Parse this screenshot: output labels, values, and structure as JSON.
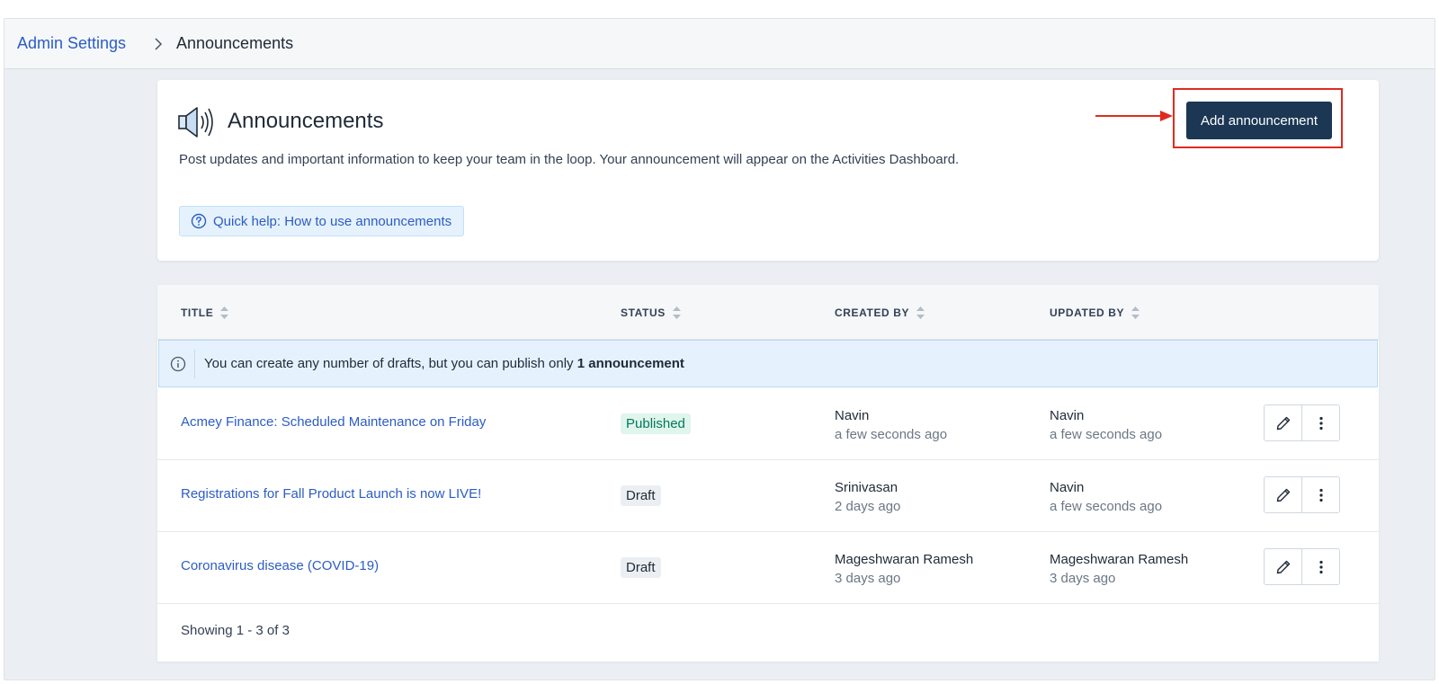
{
  "breadcrumb": {
    "parent": "Admin Settings",
    "current": "Announcements"
  },
  "header": {
    "title": "Announcements",
    "description": "Post updates and important information to keep your team in the loop. Your announcement will appear on the Activities Dashboard.",
    "help_label": "Quick help: How to use announcements",
    "add_button_label": "Add announcement",
    "highlight_color": "#e02b1f"
  },
  "table": {
    "columns": [
      "TITLE",
      "STATUS",
      "CREATED BY",
      "UPDATED BY"
    ],
    "info_text_prefix": "You can create any number of drafts, but you can publish only",
    "info_text_bold": "1 announcement",
    "rows": [
      {
        "title": "Acmey Finance: Scheduled Maintenance on Friday",
        "status": "Published",
        "created_by": "Navin",
        "created_time": "a few seconds ago",
        "updated_by": "Navin",
        "updated_time": "a few seconds ago"
      },
      {
        "title": "Registrations for Fall Product Launch is now LIVE!",
        "status": "Draft",
        "created_by": "Srinivasan",
        "created_time": "2 days ago",
        "updated_by": "Navin",
        "updated_time": "a few seconds ago"
      },
      {
        "title": "Coronavirus disease (COVID-19)",
        "status": "Draft",
        "created_by": "Mageshwaran Ramesh",
        "created_time": "3 days ago",
        "updated_by": "Mageshwaran Ramesh",
        "updated_time": "3 days ago"
      }
    ],
    "footer": "Showing 1 - 3 of 3"
  },
  "colors": {
    "link": "#2c5cc5",
    "primary_button": "#1b3754",
    "published_badge": "#00795b"
  }
}
